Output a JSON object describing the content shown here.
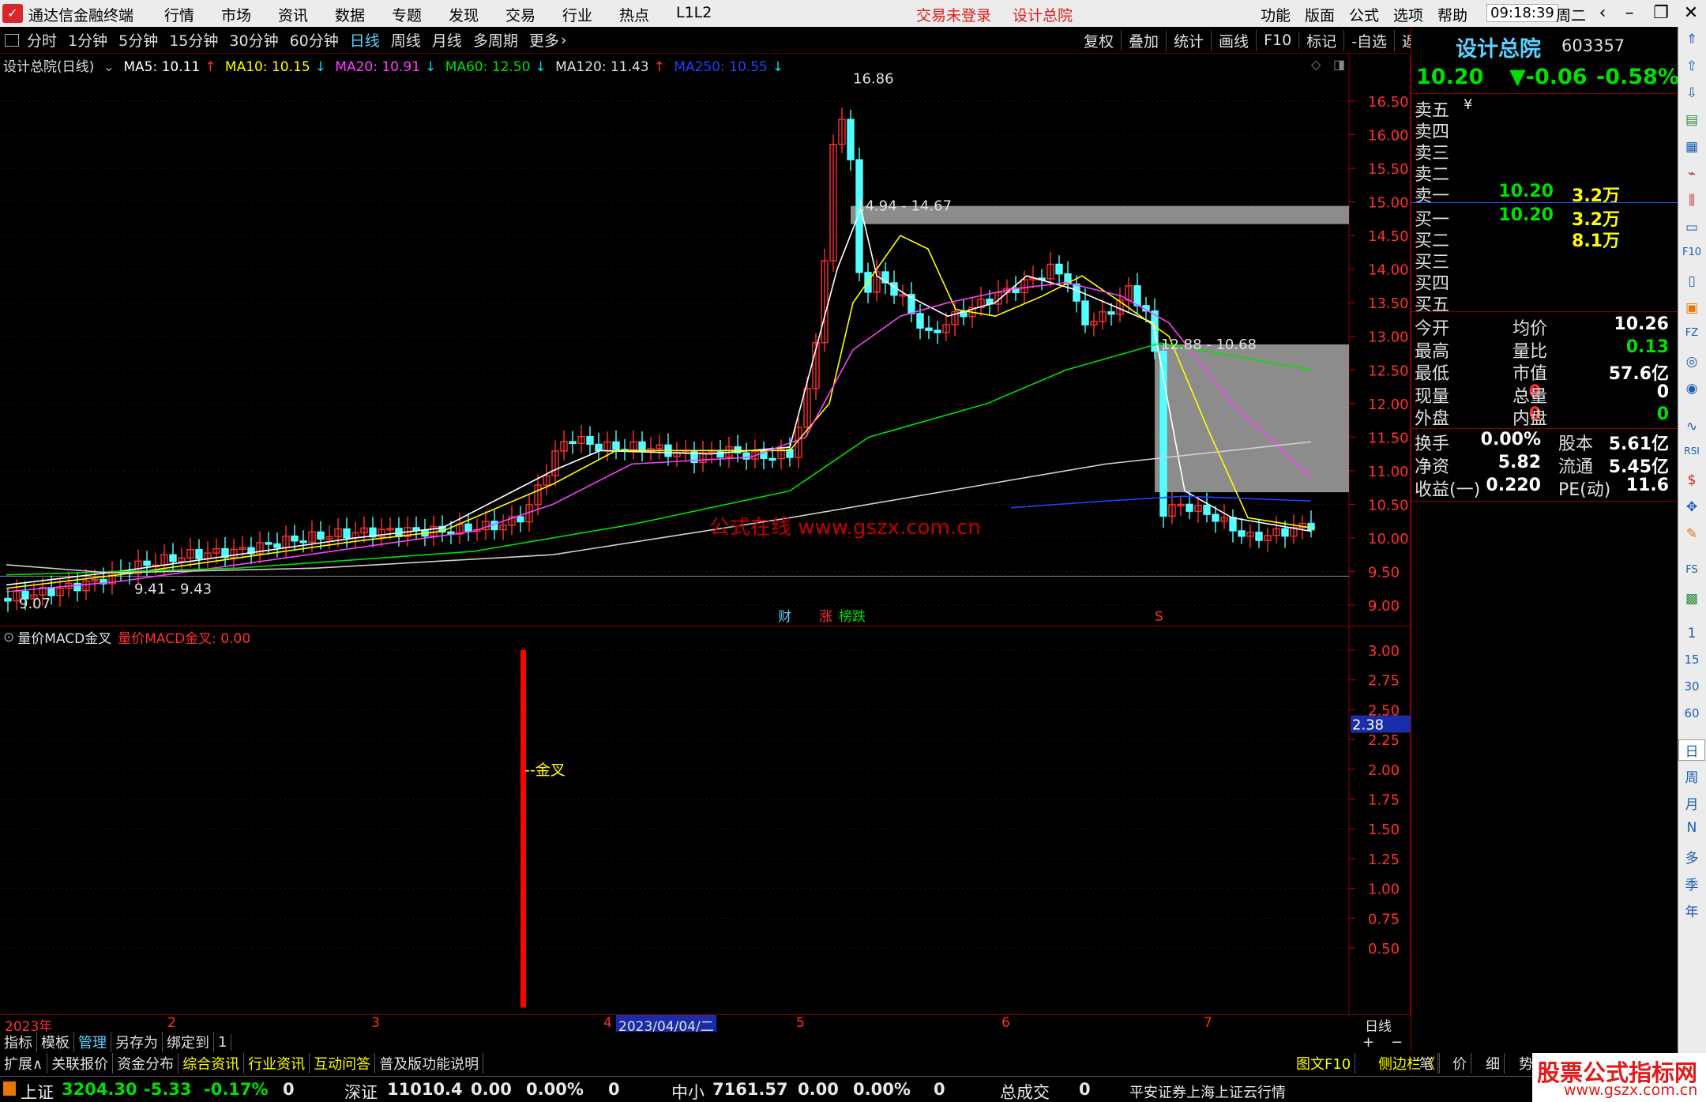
{
  "titlebar": {
    "app_title": "通达信金融终端",
    "menu": [
      "行情",
      "市场",
      "资讯",
      "数据",
      "专题",
      "发现",
      "交易",
      "行业",
      "热点",
      "L1L2"
    ],
    "trade_status": "交易未登录",
    "stock_name": "设计总院",
    "right_menu": [
      "功能",
      "版面",
      "公式",
      "选项",
      "帮助"
    ],
    "time": "09:18:39",
    "weekday": "周二"
  },
  "periods": {
    "items": [
      "分时",
      "1分钟",
      "5分钟",
      "15分钟",
      "30分钟",
      "60分钟",
      "日线",
      "周线",
      "月线",
      "多周期",
      "更多"
    ],
    "active": "日线",
    "tools": [
      "复权",
      "叠加",
      "统计",
      "画线",
      "F10",
      "标记",
      "-自选",
      "返回"
    ]
  },
  "legend": {
    "title": "设计总院(日线)",
    "ma5": "MA5: 10.11",
    "ma10": "MA10: 10.15",
    "ma20": "MA20: 10.91",
    "ma60": "MA60: 12.50",
    "ma120": "MA120: 11.43",
    "ma250": "MA250: 10.55",
    "arrows": [
      "↑",
      "↓",
      "↓",
      "↓",
      "↑",
      "↓"
    ],
    "colors": {
      "ma5": "#ffffff",
      "ma10": "#ffff00",
      "ma20": "#ff40ff",
      "ma60": "#00e000",
      "ma120": "#ffffff",
      "ma250": "#0000ff"
    }
  },
  "sublegend": {
    "name": "量价MACD金叉",
    "value_text": "量价MACD金叉: 0.00"
  },
  "quote": {
    "name": "设计总院",
    "code": "603357",
    "price": "10.20",
    "change": "▼-0.06",
    "change_pct": "-0.58%",
    "yen": "¥",
    "asks": [
      {
        "label": "卖五",
        "price": "",
        "vol": ""
      },
      {
        "label": "卖四",
        "price": "",
        "vol": ""
      },
      {
        "label": "卖三",
        "price": "",
        "vol": ""
      },
      {
        "label": "卖二",
        "price": "",
        "vol": ""
      },
      {
        "label": "卖一",
        "price": "10.20",
        "vol": "3.2万"
      }
    ],
    "bids": [
      {
        "label": "买一",
        "price": "10.20",
        "vol": "3.2万"
      },
      {
        "label": "买二",
        "price": "",
        "vol": "8.1万"
      },
      {
        "label": "买三",
        "price": "",
        "vol": ""
      },
      {
        "label": "买四",
        "price": "",
        "vol": ""
      },
      {
        "label": "买五",
        "price": "",
        "vol": ""
      }
    ],
    "stats1": [
      {
        "l1": "今开",
        "v1": "",
        "l2": "均价",
        "v2": "10.26",
        "c2": "#ffffff"
      },
      {
        "l1": "最高",
        "v1": "",
        "l2": "量比",
        "v2": "0.13",
        "c2": "#00e000"
      },
      {
        "l1": "最低",
        "v1": "",
        "l2": "市值",
        "v2": "57.6亿",
        "c2": "#ffffff"
      },
      {
        "l1": "现量",
        "v1": "0",
        "l2": "总量",
        "v2": "0",
        "c1": "#ff3030",
        "c2": "#ffffff"
      },
      {
        "l1": "外盘",
        "v1": "0",
        "l2": "内盘",
        "v2": "0",
        "c1": "#ff3030",
        "c2": "#00e000"
      }
    ],
    "stats2": [
      {
        "l1": "换手",
        "v1": "0.00%",
        "l2": "股本",
        "v2": "5.61亿"
      },
      {
        "l1": "净资",
        "v1": "5.82",
        "l2": "流通",
        "v2": "5.45亿"
      },
      {
        "l1": "收益(一)",
        "v1": "0.220",
        "l2": "PE(动)",
        "v2": "11.6"
      }
    ]
  },
  "iconstrip": [
    "1",
    "15",
    "30",
    "60",
    "日",
    "周",
    "月",
    "N",
    "多",
    "季",
    "年"
  ],
  "chart": {
    "price_ticks": [
      "16.50",
      "16.00",
      "15.50",
      "15.00",
      "14.50",
      "14.00",
      "13.50",
      "13.00",
      "12.50",
      "12.00",
      "11.50",
      "11.00",
      "10.50",
      "10.00",
      "9.50",
      "9.00"
    ],
    "annotations": {
      "high": "16.86",
      "low": "9.07",
      "zone1": "14.94 - 14.67",
      "zone2": "12.88 - 10.68",
      "zone3": "9.41 - 9.43",
      "watermark": "公式在线  www.gszx.com.cn"
    },
    "event_marks": [
      "财",
      "涨",
      "榜跌",
      "S"
    ],
    "sub_ticks": [
      "3.00",
      "2.75",
      "2.50",
      "2.25",
      "2.00",
      "1.75",
      "1.50",
      "1.25",
      "1.00",
      "0.75",
      "0.50"
    ],
    "sub_cursor_value": "2.38",
    "golden_cross_label": "--金叉",
    "date_axis": [
      "2023年",
      "2",
      "3",
      "4",
      "5",
      "6",
      "7"
    ],
    "cursor_date": "2023/04/04/二",
    "period_label": "日线",
    "zoom": [
      "+",
      "−"
    ]
  },
  "tabs1": [
    "指标",
    "模板",
    "管理",
    "另存为",
    "绑定到",
    "1"
  ],
  "tabs1_active": "管理",
  "tabs2": [
    "扩展∧",
    "关联报价",
    "资金分布",
    "综合资讯",
    "行业资讯",
    "互动问答",
    "普及版功能说明"
  ],
  "tabs2_right": [
    "图文F10",
    "侧边栏《",
    "笔",
    "价",
    "细",
    "势"
  ],
  "statusbar": {
    "sh_label": "上证",
    "sh_val": "3204.30",
    "sh_chg": "-5.33",
    "sh_pct": "-0.17%",
    "sh_vol": "0",
    "sz_label": "深证",
    "sz_val": "11010.4",
    "sz_chg": "0.00",
    "sz_pct": "0.00%",
    "sz_vol": "0",
    "zx_label": "中小",
    "zx_val": "7161.57",
    "zx_chg": "0.00",
    "zx_pct": "0.00%",
    "zx_vol": "0",
    "total_label": "总成交",
    "total_val": "0",
    "feed": "平安证券上海上证云行情"
  },
  "brand": {
    "line1": "股票公式指标网",
    "line2": "www.gszx.com.cn"
  }
}
